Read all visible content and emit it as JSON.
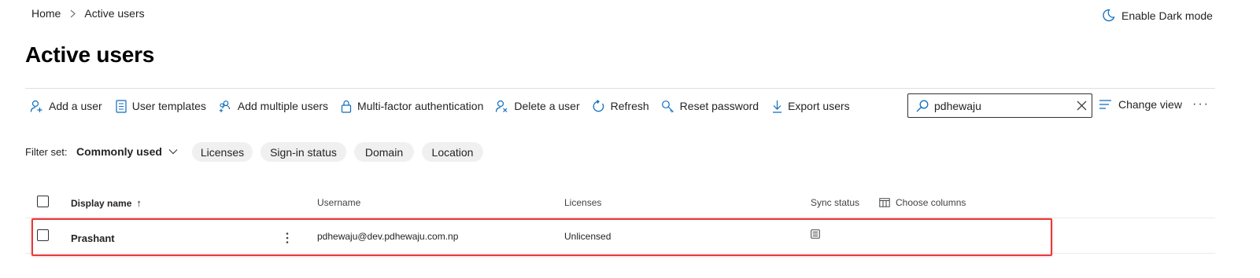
{
  "breadcrumb": {
    "home": "Home",
    "current": "Active users"
  },
  "header": {
    "dark_mode_label": "Enable Dark mode"
  },
  "page": {
    "title": "Active users"
  },
  "toolbar": {
    "add_user": "Add a user",
    "user_templates": "User templates",
    "add_multiple_users": "Add multiple users",
    "mfa": "Multi-factor authentication",
    "delete_user": "Delete a user",
    "refresh": "Refresh",
    "reset_password": "Reset password",
    "export_users": "Export users",
    "change_view": "Change view",
    "more": "···"
  },
  "search": {
    "value": "pdhewaju"
  },
  "filters": {
    "label": "Filter set:",
    "selected": "Commonly used",
    "pills": [
      "Licenses",
      "Sign-in status",
      "Domain",
      "Location"
    ]
  },
  "table": {
    "columns": {
      "display_name": "Display name",
      "sort_indicator": "↑",
      "username": "Username",
      "licenses": "Licenses",
      "sync_status": "Sync status",
      "choose_columns": "Choose columns"
    },
    "rows": [
      {
        "display_name": "Prashant",
        "username": "pdhewaju@dev.pdhewaju.com.np",
        "licenses": "Unlicensed",
        "sync_icon": "cloud-user-icon"
      }
    ]
  },
  "colors": {
    "highlight": "#e7393c",
    "icon_accent": "#0f6cbd"
  }
}
